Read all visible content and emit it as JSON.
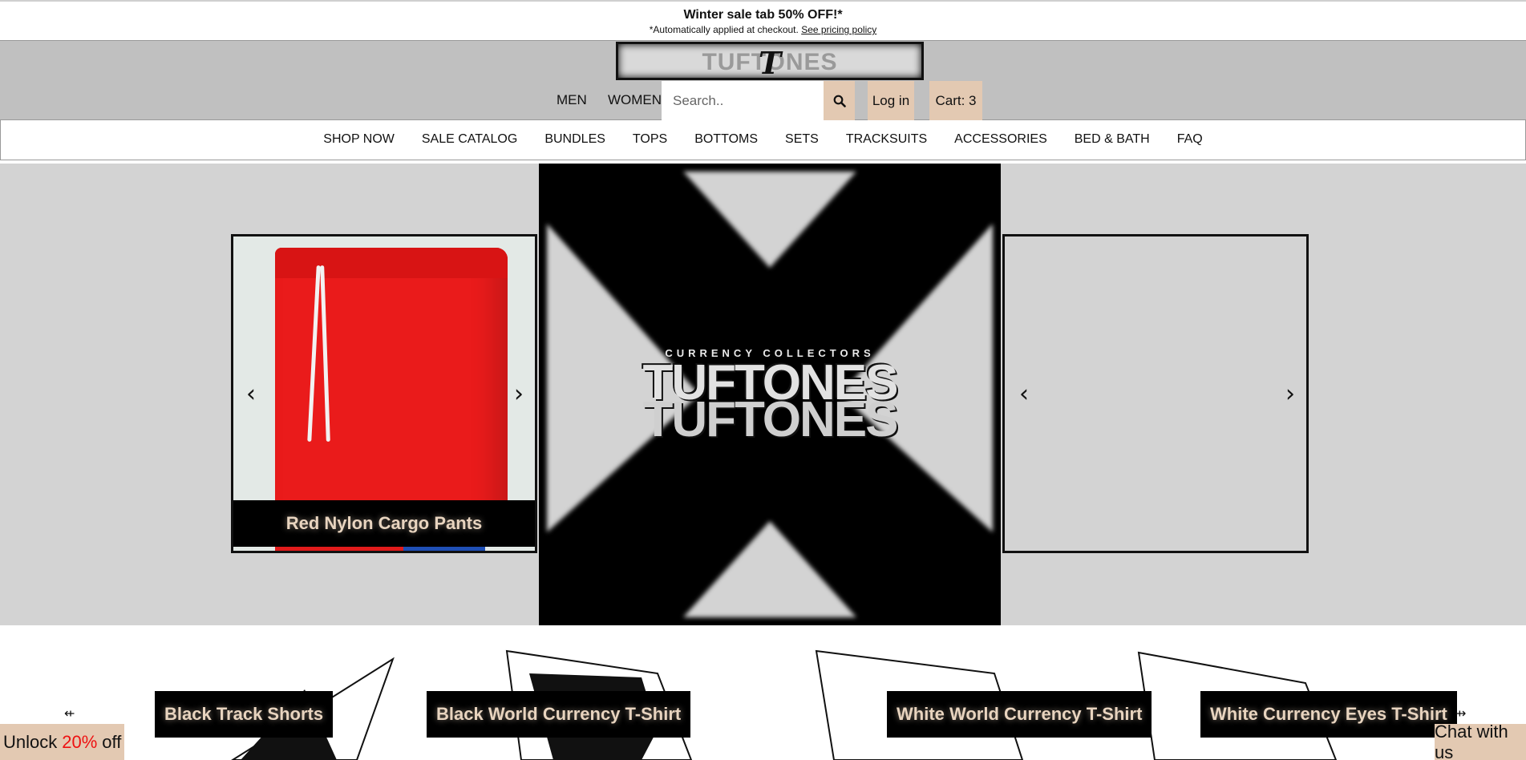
{
  "announcement": {
    "headline": "Winter sale tab 50% OFF!*",
    "note": "*Automatically applied at checkout.",
    "policy_link": "See pricing policy"
  },
  "header": {
    "logo_ghost_text": "TUFTONES",
    "logo_mark": "T",
    "nav": [
      "MEN",
      "WOMEN"
    ],
    "search": {
      "placeholder": "Search..",
      "value": ""
    },
    "login_label": "Log in",
    "cart_label": "Cart: 3"
  },
  "category_nav": [
    "SHOP NOW",
    "SALE CATALOG",
    "BUNDLES",
    "TOPS",
    "BOTTOMS",
    "SETS",
    "TRACKSUITS",
    "ACCESSORIES",
    "BED & BATH",
    "FAQ"
  ],
  "hero": {
    "left_product": "Red Nylon Cargo Pants",
    "center_logo_sub": "CURRENCY COLLECTORS",
    "center_logo_main": "TUFTONES",
    "prev_symbol": "‹",
    "next_symbol": "›"
  },
  "product_strip": {
    "items": [
      "Black Track Shorts",
      "Black World Currency T-Shirt",
      "White World Currency T-Shirt",
      "White Currency Eyes T-Shirt"
    ]
  },
  "promo": {
    "pre": "Unlock",
    "highlight": "20%",
    "post": "off"
  },
  "chat_label": "Chat with us",
  "colors": {
    "accent": "#e3c9b2",
    "header_bg": "#c0c0c0",
    "hero_bg": "#d3d3d3",
    "promo_highlight": "#ee1111"
  },
  "icons": [
    "search-icon",
    "chevron-left-icon",
    "chevron-right-icon",
    "collapse-arrow-icon"
  ]
}
